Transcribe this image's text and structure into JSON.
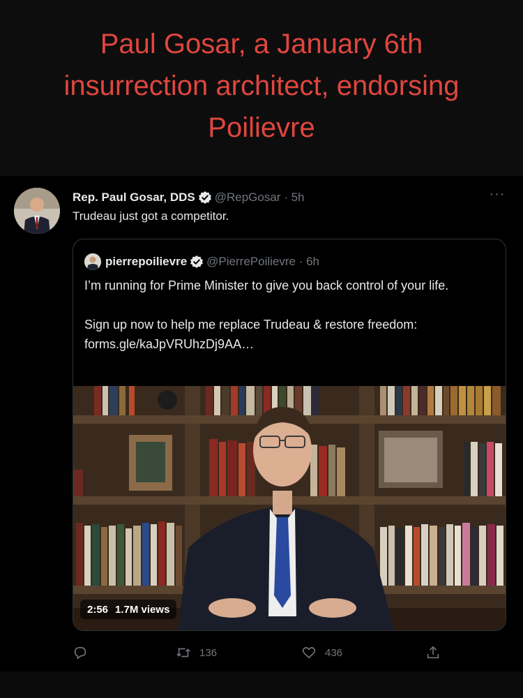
{
  "headline": "Paul Gosar, a January 6th insurrection architect, endorsing Poilievre",
  "tweet": {
    "author_name": "Rep. Paul Gosar, DDS",
    "meta": "@RepGosar · 5h",
    "text": "Trudeau just got a competitor.",
    "more": "···"
  },
  "quote": {
    "author_name": "pierrepoilievre",
    "meta": "@PierrePoilievre · 6h",
    "line1": "I’m running for Prime Minister to give you back control of your life.",
    "line2": "Sign up now to help me replace Trudeau & restore freedom: forms.gle/kaJpVRUhzDj9AA…"
  },
  "video": {
    "duration": "2:56",
    "views": "1.7M views"
  },
  "actions": {
    "reply_icon": "reply-icon",
    "retweet_icon": "retweet-icon",
    "retweet_count": "136",
    "like_icon": "heart-icon",
    "like_count": "436",
    "share_icon": "share-icon"
  },
  "colors": {
    "headline": "#e0463f",
    "background": "#000000",
    "text": "#e7e9ea",
    "muted": "#71767b",
    "border": "#2f3336"
  }
}
